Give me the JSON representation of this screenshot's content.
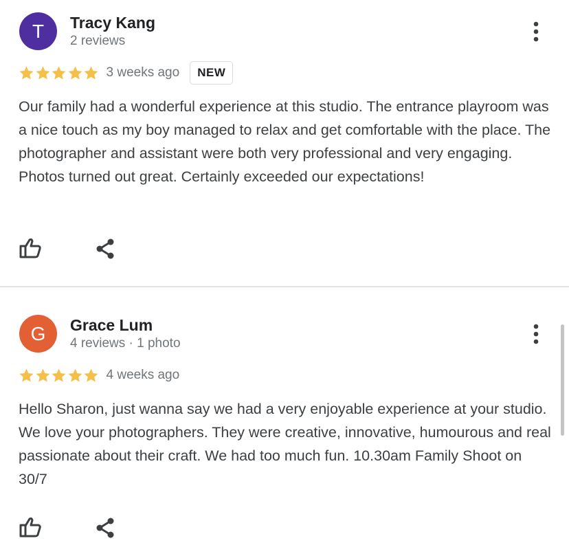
{
  "colors": {
    "star": "#f4c04a",
    "avatar_r1": "#4f2ea0",
    "avatar_r2": "#e35f34",
    "secondary_text": "#70757a",
    "icon": "#3c4043"
  },
  "reviews": [
    {
      "initial": "T",
      "name": "Tracy Kang",
      "meta": "2 reviews",
      "rating": 5,
      "time": "3 weeks ago",
      "badge": "NEW",
      "text": "Our family had a wonderful experience at this studio. The entrance playroom was a nice touch as my boy managed to relax and get comfortable with the place. The photographer and assistant were both very professional and very engaging. Photos turned out great. Certainly exceeded our expectations!",
      "icons": {
        "more": "more-vert-icon",
        "like": "thumbs-up-icon",
        "share": "share-icon"
      }
    },
    {
      "initial": "G",
      "name": "Grace Lum",
      "meta": "4 reviews · 1 photo",
      "rating": 5,
      "time": "4 weeks ago",
      "text": "Hello Sharon, just wanna say we had a very enjoyable experience at your studio. We love your photographers. They were creative, innovative, humourous and real passionate about their craft. We had too much fun. 10.30am Family Shoot on 30/7",
      "icons": {
        "more": "more-vert-icon",
        "like": "thumbs-up-icon",
        "share": "share-icon"
      }
    }
  ]
}
